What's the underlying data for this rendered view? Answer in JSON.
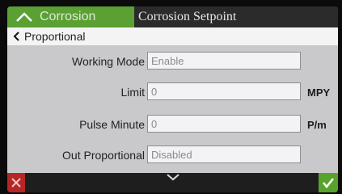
{
  "header": {
    "active_tab": "Corrosion",
    "inactive_tab": "Corrosion Setpoint"
  },
  "breadcrumb": {
    "label": "Proportional"
  },
  "form": {
    "rows": [
      {
        "label": "Working Mode",
        "value": "Enable",
        "unit": ""
      },
      {
        "label": "Limit",
        "value": "0",
        "unit": "MPY"
      },
      {
        "label": "Pulse Minute",
        "value": "0",
        "unit": "P/m"
      },
      {
        "label": "Out Proportional",
        "value": "Disabled",
        "unit": ""
      }
    ]
  },
  "icons": {
    "tab": "chevron-up-icon",
    "back": "chevron-left-icon",
    "cancel": "close-icon",
    "confirm": "check-icon",
    "scroll": "chevron-down-icon"
  },
  "colors": {
    "accent_green": "#5aa032",
    "cancel_red": "#b52626",
    "confirm_green": "#57a32c"
  }
}
